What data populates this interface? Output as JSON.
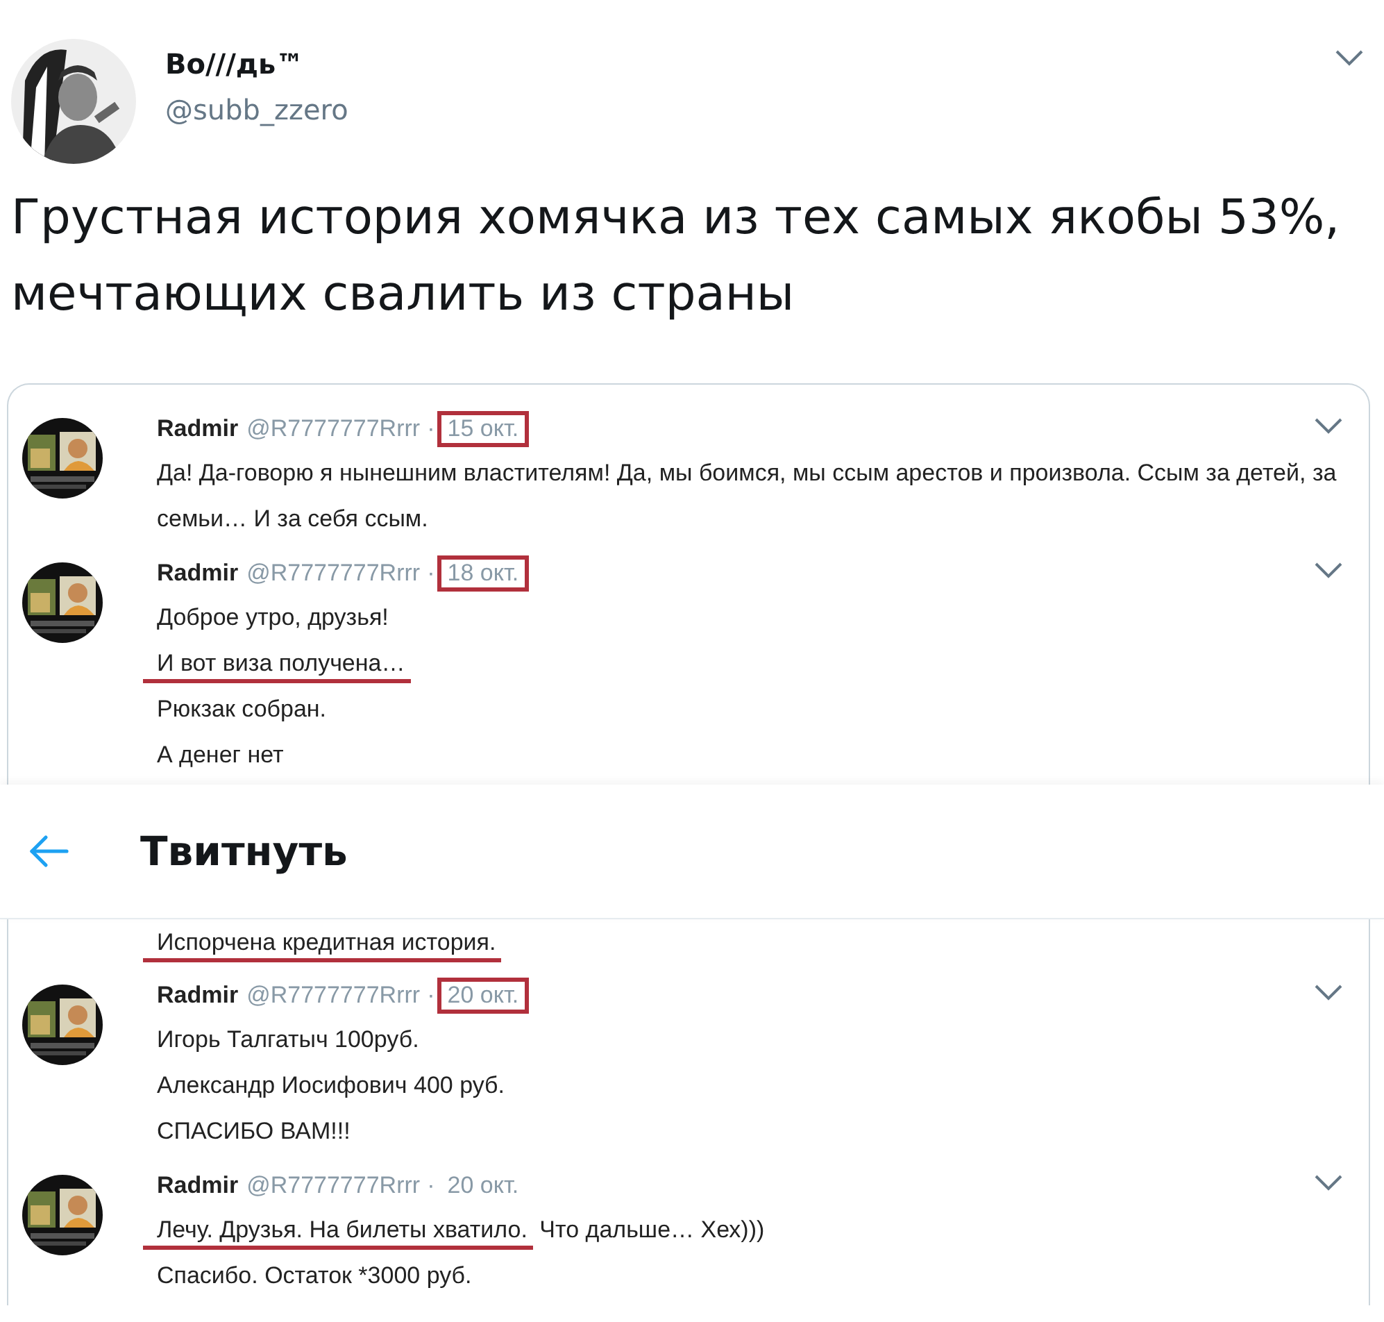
{
  "tweet": {
    "author": {
      "name": "Во///дь™",
      "handle": "@subb_zzero"
    },
    "text": "Грустная история хомячка из тех самых якобы 53%, мечтающих свалить из страны",
    "image_top": {
      "tweets": [
        {
          "name": "Radmir",
          "handle": "@R7777777Rrrr",
          "separator": "·",
          "date": "15 окт.",
          "date_boxed": true,
          "lines": [
            {
              "text": "Да! Да-говорю я нынешним властителям! Да, мы боимся, мы ссым арестов и произвола. Ссым за детей, за семьи… И за себя ссым.",
              "underlined": false
            }
          ]
        },
        {
          "name": "Radmir",
          "handle": "@R7777777Rrrr",
          "separator": "·",
          "date": "18 окт.",
          "date_boxed": true,
          "lines": [
            {
              "text": "Доброе утро, друзья!",
              "underlined": false
            },
            {
              "text": "И вот виза получена…",
              "underlined": true
            },
            {
              "text": "Рюкзак собран.",
              "underlined": false
            },
            {
              "text": "А денег нет",
              "underlined": false
            }
          ]
        }
      ]
    }
  },
  "header": {
    "title": "Твитнуть"
  },
  "image_bottom": {
    "continued_lines": [
      {
        "text": "Испорчена кредитная история.",
        "underlined": true
      }
    ],
    "tweets": [
      {
        "name": "Radmir",
        "handle": "@R7777777Rrrr",
        "separator": "·",
        "date": "20 окт.",
        "date_boxed": true,
        "lines": [
          {
            "text": "Игорь Талгатыч 100руб.",
            "underlined": false
          },
          {
            "text": "Александр Иосифович 400 руб.",
            "underlined": false
          },
          {
            "text": "СПАСИБО ВАМ!!!",
            "underlined": false
          }
        ]
      },
      {
        "name": "Radmir",
        "handle": "@R7777777Rrrr",
        "separator": "·",
        "date": "20 окт.",
        "date_boxed": false,
        "lines": [
          {
            "text": "Лечу. Друзья. На билеты хватило.",
            "underlined": true,
            "tail": " Что дальше… Хех)))"
          },
          {
            "text": "Спасибо. Остаток *3000 руб.",
            "underlined": false
          }
        ]
      }
    ]
  }
}
